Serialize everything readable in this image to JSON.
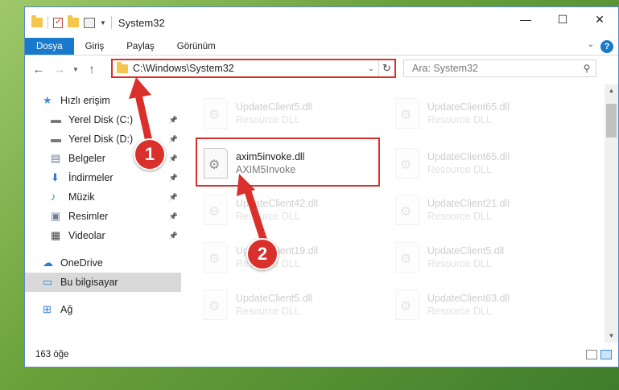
{
  "window": {
    "title": "System32",
    "controls": {
      "minimize": "—",
      "maximize": "☐",
      "close": "✕"
    }
  },
  "ribbon": {
    "tabs": [
      "Dosya",
      "Giriş",
      "Paylaş",
      "Görünüm"
    ],
    "help": "?"
  },
  "address": {
    "path": "C:\\Windows\\System32",
    "search_placeholder": "Ara: System32"
  },
  "sidebar": {
    "items": [
      {
        "label": "Hızlı erişim",
        "icon": "star-icon",
        "pinned": false
      },
      {
        "label": "Yerel Disk (C:)",
        "icon": "drive-icon",
        "pinned": true
      },
      {
        "label": "Yerel Disk (D:)",
        "icon": "drive-icon",
        "pinned": true
      },
      {
        "label": "Belgeler",
        "icon": "documents-icon",
        "pinned": true
      },
      {
        "label": "İndirmeler",
        "icon": "downloads-icon",
        "pinned": true
      },
      {
        "label": "Müzik",
        "icon": "music-icon",
        "pinned": true
      },
      {
        "label": "Resimler",
        "icon": "pictures-icon",
        "pinned": true
      },
      {
        "label": "Videolar",
        "icon": "videos-icon",
        "pinned": true
      },
      {
        "label": "OneDrive",
        "icon": "cloud-icon",
        "pinned": false
      },
      {
        "label": "Bu bilgisayar",
        "icon": "computer-icon",
        "pinned": false,
        "selected": true
      },
      {
        "label": "Ağ",
        "icon": "network-icon",
        "pinned": false
      }
    ]
  },
  "files": {
    "left": [
      {
        "name": "UpdateClient5.dll",
        "type": "Resource DLL"
      },
      {
        "name": "axim5invoke.dll",
        "type": "AXIM5Invoke",
        "highlighted": true
      },
      {
        "name": "UpdateClient42.dll",
        "type": "Resource DLL"
      },
      {
        "name": "UpdateClient19.dll",
        "type": "Resource DLL"
      },
      {
        "name": "UpdateClient5.dll",
        "type": "Resource DLL"
      }
    ],
    "right": [
      {
        "name": "UpdateClient65.dll",
        "type": "Resource DLL"
      },
      {
        "name": "UpdateClient65.dll",
        "type": "Resource DLL"
      },
      {
        "name": "UpdateClient21.dll",
        "type": "Resource DLL"
      },
      {
        "name": "UpdateClient5.dll",
        "type": "Resource DLL"
      },
      {
        "name": "UpdateClient63.dll",
        "type": "Resource DLL"
      }
    ]
  },
  "status": {
    "count": "163 öğe"
  },
  "annotations": {
    "step1": "1",
    "step2": "2",
    "color": "#d9302c"
  }
}
